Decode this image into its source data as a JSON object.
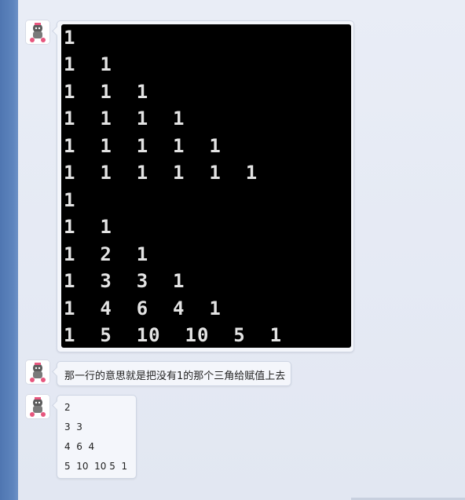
{
  "messages": [
    {
      "avatar": "cartoon-girl-avatar",
      "type": "console-image",
      "console_lines": [
        "1",
        "1  1",
        "1  1  1",
        "1  1  1  1",
        "1  1  1  1  1",
        "1  1  1  1  1  1",
        "1",
        "1  1",
        "1  2  1",
        "1  3  3  1",
        "1  4  6  4  1",
        "1  5  10  10  5  1"
      ]
    },
    {
      "avatar": "cartoon-girl-avatar",
      "type": "text",
      "text": "那一行的意思就是把没有1的那个三角给赋值上去"
    },
    {
      "avatar": "cartoon-girl-avatar",
      "type": "multiline",
      "lines": [
        "2",
        "3  3",
        "4  6  4",
        "5  10  10 5  1"
      ]
    }
  ],
  "colors": {
    "sidebar": "#5a80ba",
    "background": "#e4e9f3",
    "bubble": "#f4f6fb",
    "console_bg": "#000000",
    "console_fg": "#e3e3e3"
  }
}
